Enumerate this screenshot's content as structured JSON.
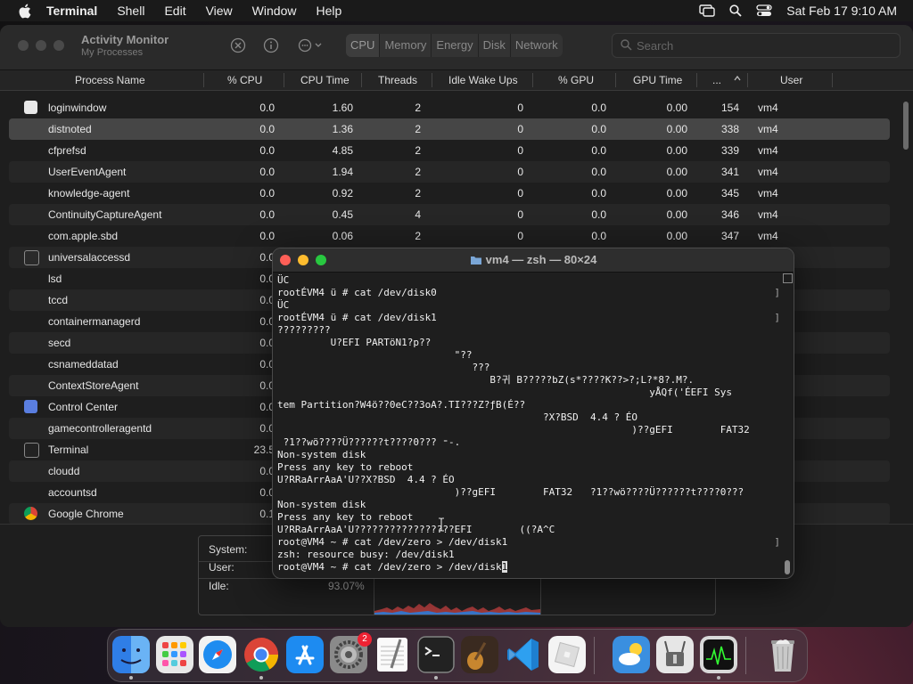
{
  "menubar": {
    "app_name": "Terminal",
    "items": [
      "Shell",
      "Edit",
      "View",
      "Window",
      "Help"
    ],
    "datetime": "Sat Feb 17  9:10 AM"
  },
  "activity_monitor": {
    "title": "Activity Monitor",
    "subtitle": "My Processes",
    "tabs": [
      "CPU",
      "Memory",
      "Energy",
      "Disk",
      "Network"
    ],
    "active_tab": "CPU",
    "search_placeholder": "Search",
    "columns": [
      "Process Name",
      "% CPU",
      "CPU Time",
      "Threads",
      "Idle Wake Ups",
      "% GPU",
      "GPU Time",
      "...",
      "User"
    ],
    "rows": [
      {
        "name": "loginwindow",
        "cpu": "0.0",
        "cpu_time": "1.60",
        "threads": "2",
        "idle": "0",
        "gpu": "0.0",
        "gpu_time": "0.00",
        "pid": "154",
        "user": "vm4",
        "icon": "window-icon"
      },
      {
        "name": "distnoted",
        "cpu": "0.0",
        "cpu_time": "1.36",
        "threads": "2",
        "idle": "0",
        "gpu": "0.0",
        "gpu_time": "0.00",
        "pid": "338",
        "user": "vm4",
        "icon": ""
      },
      {
        "name": "cfprefsd",
        "cpu": "0.0",
        "cpu_time": "4.85",
        "threads": "2",
        "idle": "0",
        "gpu": "0.0",
        "gpu_time": "0.00",
        "pid": "339",
        "user": "vm4",
        "icon": ""
      },
      {
        "name": "UserEventAgent",
        "cpu": "0.0",
        "cpu_time": "1.94",
        "threads": "2",
        "idle": "0",
        "gpu": "0.0",
        "gpu_time": "0.00",
        "pid": "341",
        "user": "vm4",
        "icon": ""
      },
      {
        "name": "knowledge-agent",
        "cpu": "0.0",
        "cpu_time": "0.92",
        "threads": "2",
        "idle": "0",
        "gpu": "0.0",
        "gpu_time": "0.00",
        "pid": "345",
        "user": "vm4",
        "icon": ""
      },
      {
        "name": "ContinuityCaptureAgent",
        "cpu": "0.0",
        "cpu_time": "0.45",
        "threads": "4",
        "idle": "0",
        "gpu": "0.0",
        "gpu_time": "0.00",
        "pid": "346",
        "user": "vm4",
        "icon": ""
      },
      {
        "name": "com.apple.sbd",
        "cpu": "0.0",
        "cpu_time": "0.06",
        "threads": "2",
        "idle": "0",
        "gpu": "0.0",
        "gpu_time": "0.00",
        "pid": "347",
        "user": "vm4",
        "icon": ""
      },
      {
        "name": "universalaccessd",
        "cpu": "0.0",
        "cpu_time": "",
        "threads": "",
        "idle": "",
        "gpu": "",
        "gpu_time": "",
        "pid": "",
        "user": "",
        "icon": "accessibility-icon"
      },
      {
        "name": "lsd",
        "cpu": "0.0",
        "cpu_time": "",
        "threads": "",
        "idle": "",
        "gpu": "",
        "gpu_time": "",
        "pid": "",
        "user": "",
        "icon": ""
      },
      {
        "name": "tccd",
        "cpu": "0.0",
        "cpu_time": "",
        "threads": "",
        "idle": "",
        "gpu": "",
        "gpu_time": "",
        "pid": "",
        "user": "",
        "icon": ""
      },
      {
        "name": "containermanagerd",
        "cpu": "0.0",
        "cpu_time": "",
        "threads": "",
        "idle": "",
        "gpu": "",
        "gpu_time": "",
        "pid": "",
        "user": "",
        "icon": ""
      },
      {
        "name": "secd",
        "cpu": "0.0",
        "cpu_time": "",
        "threads": "",
        "idle": "",
        "gpu": "",
        "gpu_time": "",
        "pid": "",
        "user": "",
        "icon": ""
      },
      {
        "name": "csnameddatad",
        "cpu": "0.0",
        "cpu_time": "",
        "threads": "",
        "idle": "",
        "gpu": "",
        "gpu_time": "",
        "pid": "",
        "user": "",
        "icon": ""
      },
      {
        "name": "ContextStoreAgent",
        "cpu": "0.0",
        "cpu_time": "",
        "threads": "",
        "idle": "",
        "gpu": "",
        "gpu_time": "",
        "pid": "",
        "user": "",
        "icon": ""
      },
      {
        "name": "Control Center",
        "cpu": "0.0",
        "cpu_time": "",
        "threads": "",
        "idle": "",
        "gpu": "",
        "gpu_time": "",
        "pid": "",
        "user": "",
        "icon": "control-center-icon"
      },
      {
        "name": "gamecontrolleragentd",
        "cpu": "0.0",
        "cpu_time": "",
        "threads": "",
        "idle": "",
        "gpu": "",
        "gpu_time": "",
        "pid": "",
        "user": "",
        "icon": ""
      },
      {
        "name": "Terminal",
        "cpu": "23.5",
        "cpu_time": "",
        "threads": "",
        "idle": "",
        "gpu": "",
        "gpu_time": "",
        "pid": "",
        "user": "",
        "icon": "terminal-icon"
      },
      {
        "name": "cloudd",
        "cpu": "0.0",
        "cpu_time": "",
        "threads": "",
        "idle": "",
        "gpu": "",
        "gpu_time": "",
        "pid": "",
        "user": "",
        "icon": ""
      },
      {
        "name": "accountsd",
        "cpu": "0.0",
        "cpu_time": "",
        "threads": "",
        "idle": "",
        "gpu": "",
        "gpu_time": "",
        "pid": "",
        "user": "",
        "icon": ""
      },
      {
        "name": "Google Chrome",
        "cpu": "0.1",
        "cpu_time": "",
        "threads": "",
        "idle": "",
        "gpu": "",
        "gpu_time": "",
        "pid": "",
        "user": "",
        "icon": "chrome-icon"
      }
    ],
    "stats": {
      "system_label": "System:",
      "user_label": "User:",
      "idle_label": "Idle:",
      "idle_value": "93.07%"
    }
  },
  "terminal": {
    "title": "vm4 — zsh — 80×24",
    "lines": [
      "ÜC",
      "rootÉVM4 ü # cat /dev/disk0",
      "ÜC",
      "rootÉVM4 ü # cat /dev/disk1",
      "?????????",
      "         U?EFI PARTöN1?p??",
      "                              \"??",
      "                                 ???",
      "                                    B?귀 B?????bZ(s*????K??>?;L?*8?.M?.",
      "                                                               yÅQf('ÉEFI Sys",
      "tem Partition?W4ö??0eC??3oA?.TI???Z?ƒB(É??",
      "                                             ?X?BSD  4.4 ? ÉO",
      "                                                            )??gEFI        FAT32",
      " ?1??wö????Ü??????t????0??? ⁼-.",
      "Non-system disk",
      "Press any key to reboot",
      "U?RRaArrAaA'U??X?BSD  4.4 ? ÉO",
      "                              )??gEFI        FAT32   ?1??wö????Ü??????t????0???",
      "Non-system disk",
      "Press any key to reboot",
      "U?RRaArrAaA'U?????????????????EFI        ((?A^C",
      "root@VM4 ~ # cat /dev/zero > /dev/disk1",
      "zsh: resource busy: /dev/disk1",
      "root@VM4 ~ # cat /dev/zero > /dev/disk"
    ],
    "cursor_char": "1"
  },
  "dock": {
    "items": [
      "Finder",
      "Launchpad",
      "Safari",
      "Google Chrome",
      "App Store",
      "System Settings",
      "TextEdit",
      "Terminal",
      "Instruments",
      "Visual Studio Code",
      "Roblox",
      "Weather",
      "Archive Utility",
      "Activity Monitor",
      "Trash"
    ],
    "settings_badge": "2"
  }
}
